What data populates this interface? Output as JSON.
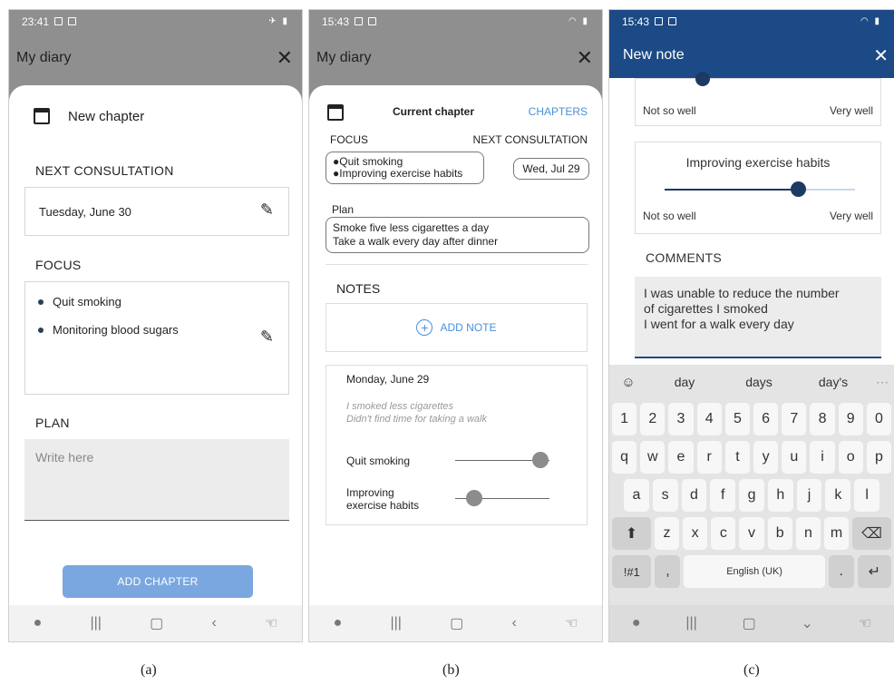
{
  "captions": [
    "(a)",
    "(b)",
    "(c)"
  ],
  "screenA": {
    "status_time": "23:41",
    "app_title": "My diary",
    "title": "New chapter",
    "next_consultation_label": "NEXT CONSULTATION",
    "next_consultation_value": "Tuesday, June 30",
    "focus_label": "FOCUS",
    "focus_items": [
      "Quit smoking",
      "Monitoring blood sugars"
    ],
    "plan_label": "PLAN",
    "plan_placeholder": "Write here",
    "add_chapter_label": "ADD CHAPTER"
  },
  "screenB": {
    "status_time": "15:43",
    "app_title": "My diary",
    "current_chapter": "Current chapter",
    "chapters_link": "CHAPTERS",
    "focus_label": "FOCUS",
    "next_consultation_label": "NEXT CONSULTATION",
    "focus_items": [
      "Quit smoking",
      "Improving exercise habits"
    ],
    "consultation_date": "Wed, Jul 29",
    "plan_label": "Plan",
    "plan_lines": [
      "Smoke five less cigarettes a day",
      "Take a walk every day after dinner"
    ],
    "notes_label": "NOTES",
    "add_note_label": "ADD NOTE",
    "note": {
      "date": "Monday, June 29",
      "text_lines": [
        "I smoked less cigarettes",
        "Didn't find time for taking a walk"
      ],
      "ratings": [
        {
          "label": "Quit smoking",
          "value": 0.9
        },
        {
          "label_lines": [
            "Improving",
            "exercise habits"
          ],
          "value": 0.2
        }
      ]
    }
  },
  "screenC": {
    "status_time": "15:43",
    "title": "New note",
    "scale_low": "Not so well",
    "scale_high": "Very well",
    "goal2_label": "Improving exercise habits",
    "goal2_value": 0.7,
    "comments_label": "COMMENTS",
    "comment_lines": [
      "I was unable to reduce the number",
      "of cigarettes I smoked",
      "I went for a walk every day"
    ],
    "suggestions": [
      "day",
      "days",
      "day's"
    ],
    "keyboard": {
      "row_numbers": [
        "1",
        "2",
        "3",
        "4",
        "5",
        "6",
        "7",
        "8",
        "9",
        "0"
      ],
      "row1": [
        "q",
        "w",
        "e",
        "r",
        "t",
        "y",
        "u",
        "i",
        "o",
        "p"
      ],
      "row2": [
        "a",
        "s",
        "d",
        "f",
        "g",
        "h",
        "j",
        "k",
        "l"
      ],
      "row3": [
        "z",
        "x",
        "c",
        "v",
        "b",
        "n",
        "m"
      ],
      "symbols_key": "!#1",
      "comma_key": ",",
      "space_label": "English (UK)",
      "period_key": "."
    }
  }
}
